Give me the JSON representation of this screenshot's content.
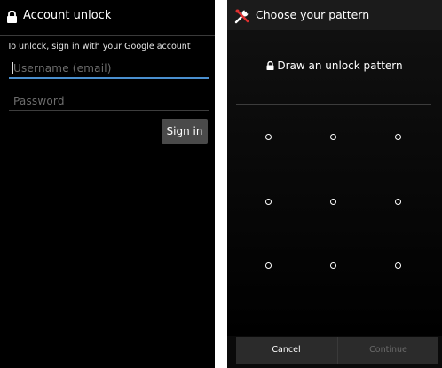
{
  "left": {
    "title": "Account unlock",
    "instruction": "To unlock, sign in with your Google account",
    "username": {
      "value": "",
      "placeholder": "Username (email)"
    },
    "password": {
      "value": "",
      "placeholder": "Password"
    },
    "signin_label": "Sign in",
    "accent_color": "#4a8fcf",
    "lock_icon": "lock-icon"
  },
  "right": {
    "title": "Choose your pattern",
    "prompt": "Draw an unlock pattern",
    "cancel_label": "Cancel",
    "continue_label": "Continue",
    "header_icon": "tools-icon",
    "grid_rows": 3,
    "grid_cols": 3
  }
}
